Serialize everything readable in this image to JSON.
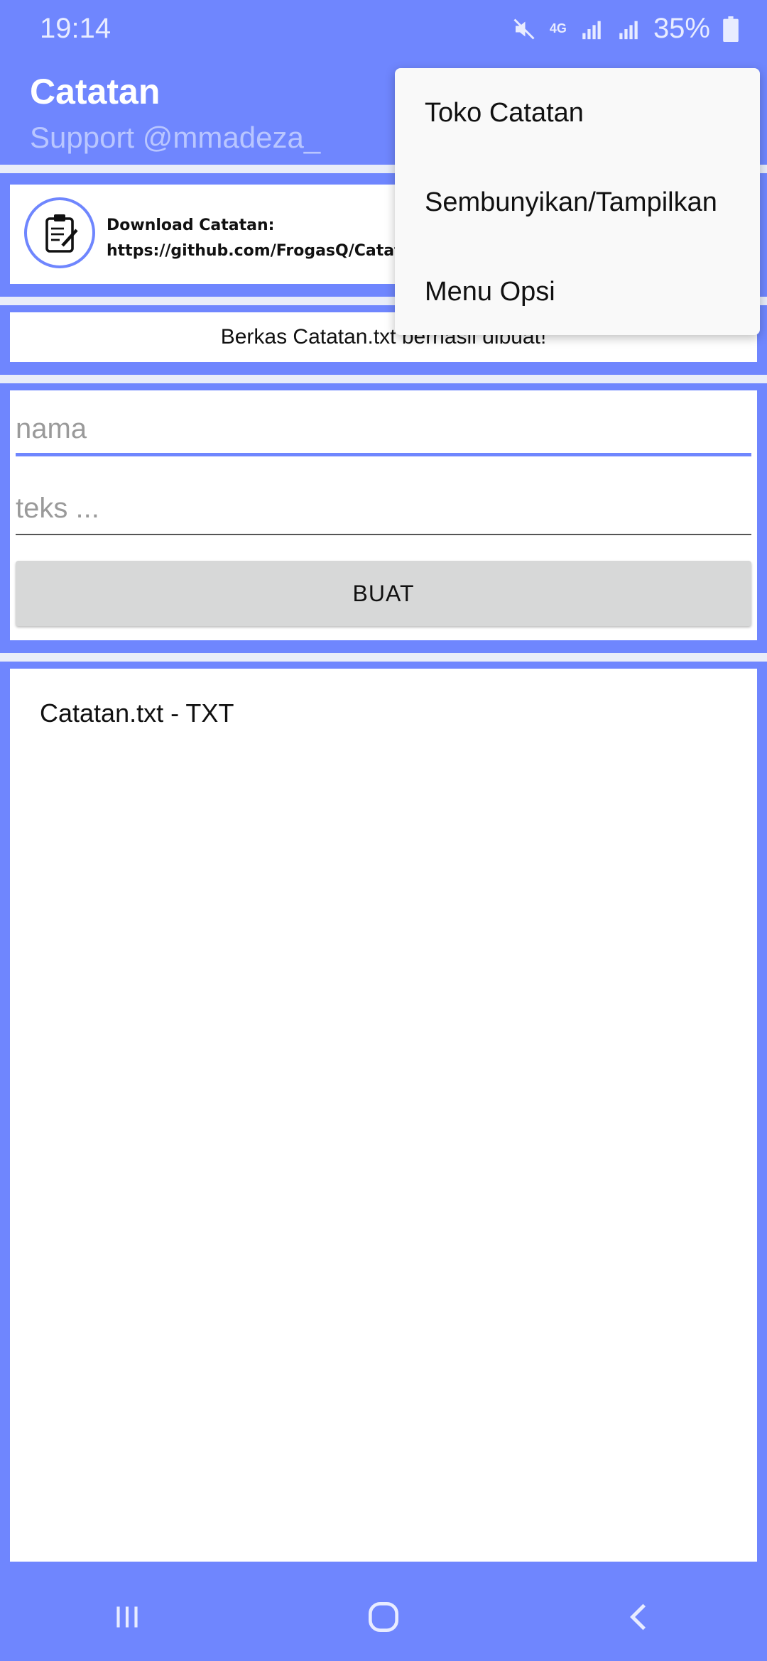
{
  "status_bar": {
    "time": "19:14",
    "network": "4G",
    "battery": "35%",
    "icons": [
      "mute-icon",
      "4g-icon",
      "signal-icon",
      "signal-icon",
      "battery-icon"
    ]
  },
  "app_bar": {
    "title": "Catatan",
    "subtitle": "Support @mmadeza_"
  },
  "banner": {
    "line1": "Download Catatan:",
    "line2": "https://github.com/FrogasQ/Catatan"
  },
  "status_message": "Berkas Catatan.txt berhasil dibuat!",
  "form": {
    "name_placeholder": "nama",
    "text_placeholder": "teks ...",
    "create_label": "BUAT"
  },
  "files": [
    {
      "label": "Catatan.txt - TXT"
    }
  ],
  "overflow_menu": {
    "items": [
      {
        "label": "Toko Catatan"
      },
      {
        "label": "Sembunyikan/Tampilkan"
      },
      {
        "label": "Menu Opsi"
      }
    ]
  },
  "colors": {
    "accent": "#6f86fe",
    "panel": "#ffffff",
    "button": "#d7d8d8"
  }
}
